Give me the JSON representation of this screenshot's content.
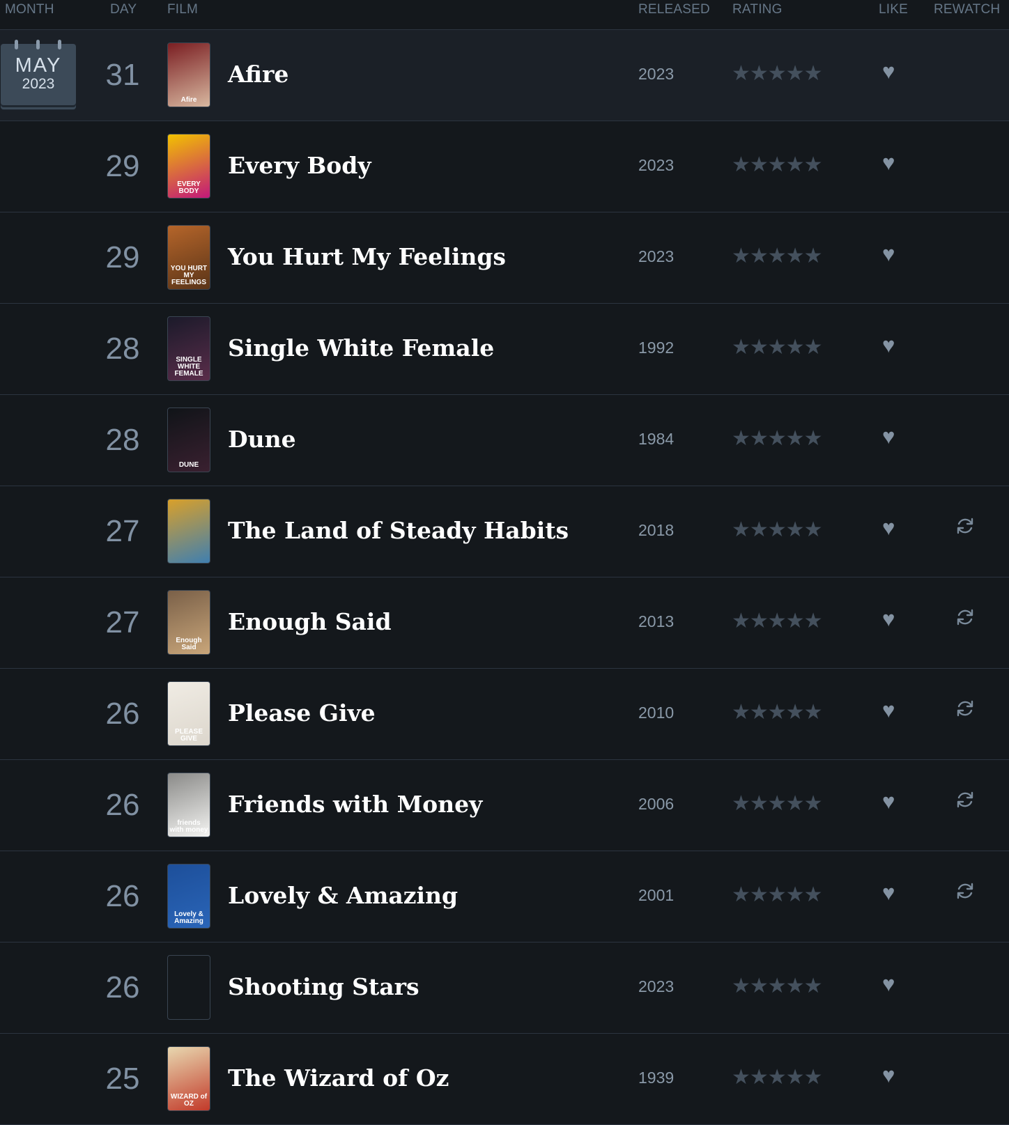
{
  "header": {
    "month": "MONTH",
    "day": "DAY",
    "film": "FILM",
    "released": "RELEASED",
    "rating": "RATING",
    "like": "LIKE",
    "rewatch": "REWATCH"
  },
  "month_badge": {
    "month": "MAY",
    "year": "2023"
  },
  "icons": {
    "star": "★★★★★",
    "heart": "♥"
  },
  "entries": [
    {
      "day": "31",
      "title": "Afire",
      "year": "2023",
      "stars": 5,
      "liked": true,
      "rewatch": false,
      "poster": {
        "text": "Afire",
        "colors": [
          "#7a1e22",
          "#d8b8a0"
        ]
      }
    },
    {
      "day": "29",
      "title": "Every Body",
      "year": "2023",
      "stars": 5,
      "liked": true,
      "rewatch": false,
      "poster": {
        "text": "EVERY BODY",
        "colors": [
          "#f2c200",
          "#c2187a"
        ]
      }
    },
    {
      "day": "29",
      "title": "You Hurt My Feelings",
      "year": "2023",
      "stars": 5,
      "liked": true,
      "rewatch": false,
      "poster": {
        "text": "YOU HURT MY FEELINGS",
        "colors": [
          "#b5652a",
          "#5a3418"
        ]
      }
    },
    {
      "day": "28",
      "title": "Single White Female",
      "year": "1992",
      "stars": 5,
      "liked": true,
      "rewatch": false,
      "poster": {
        "text": "SINGLE WHITE FEMALE",
        "colors": [
          "#1b1a2a",
          "#5a2d4a"
        ]
      }
    },
    {
      "day": "28",
      "title": "Dune",
      "year": "1984",
      "stars": 5,
      "liked": true,
      "rewatch": false,
      "poster": {
        "text": "DUNE",
        "colors": [
          "#101418",
          "#3a2030"
        ]
      }
    },
    {
      "day": "27",
      "title": "The Land of Steady Habits",
      "year": "2018",
      "stars": 5,
      "liked": true,
      "rewatch": true,
      "poster": {
        "text": "",
        "colors": [
          "#d9a02a",
          "#3f7fb0"
        ]
      }
    },
    {
      "day": "27",
      "title": "Enough Said",
      "year": "2013",
      "stars": 5,
      "liked": true,
      "rewatch": true,
      "poster": {
        "text": "Enough Said",
        "colors": [
          "#7a6048",
          "#c9a67a"
        ]
      }
    },
    {
      "day": "26",
      "title": "Please Give",
      "year": "2010",
      "stars": 5,
      "liked": true,
      "rewatch": true,
      "poster": {
        "text": "PLEASE GIVE",
        "colors": [
          "#f0ece4",
          "#dcd6cc"
        ]
      }
    },
    {
      "day": "26",
      "title": "Friends with Money",
      "year": "2006",
      "stars": 5,
      "liked": true,
      "rewatch": true,
      "poster": {
        "text": "friends with money",
        "colors": [
          "#8a8a88",
          "#f4f4f2"
        ]
      }
    },
    {
      "day": "26",
      "title": "Lovely & Amazing",
      "year": "2001",
      "stars": 5,
      "liked": true,
      "rewatch": true,
      "poster": {
        "text": "Lovely & Amazing",
        "colors": [
          "#1d4f9a",
          "#2a65b8"
        ]
      }
    },
    {
      "day": "26",
      "title": "Shooting Stars",
      "year": "2023",
      "stars": 5,
      "liked": true,
      "rewatch": false,
      "poster": {
        "text": "",
        "colors": [
          "#14181c",
          "#14181c"
        ]
      }
    },
    {
      "day": "25",
      "title": "The Wizard of Oz",
      "year": "1939",
      "stars": 5,
      "liked": true,
      "rewatch": false,
      "poster": {
        "text": "WIZARD of OZ",
        "colors": [
          "#e8d8b0",
          "#c23a2a"
        ]
      }
    }
  ]
}
